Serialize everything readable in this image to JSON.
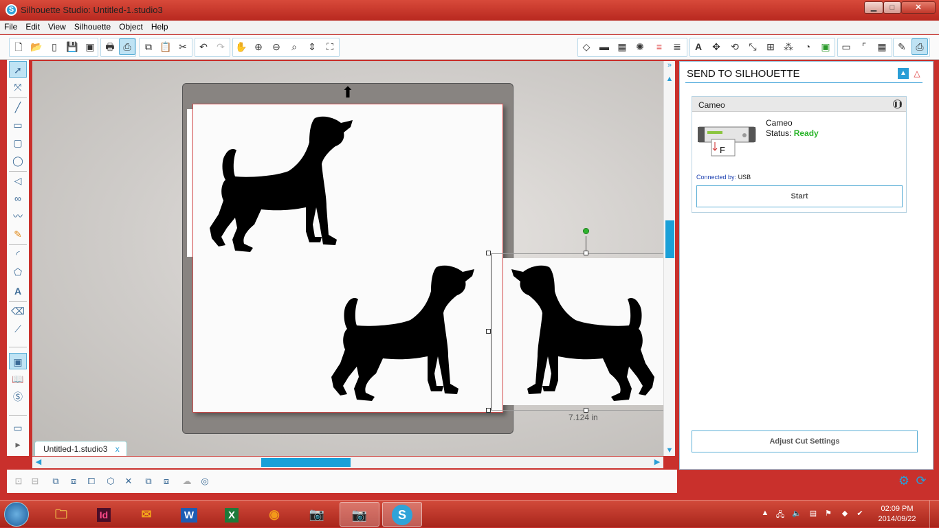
{
  "window": {
    "title": "Silhouette Studio: Untitled-1.studio3",
    "minimize": "▁",
    "maximize": "□",
    "close": "✕"
  },
  "menu": [
    "File",
    "Edit",
    "View",
    "Silhouette",
    "Object",
    "Help"
  ],
  "document": {
    "tab_label": "Untitled-1.studio3",
    "tab_close": "x",
    "dimension_label": "7.124 in"
  },
  "panel": {
    "title": "SEND TO SILHOUETTE",
    "device_header": "Cameo",
    "device_name": "Cameo",
    "status_label": "Status:",
    "status_value": "Ready",
    "connected_label": "Connected by:",
    "connected_value": "USB",
    "start_button": "Start",
    "adjust_button": "Adjust Cut Settings",
    "status_color": "#28b428"
  },
  "taskbar": {
    "clock_time": "02:09 PM",
    "clock_date": "2014/09/22"
  },
  "colors": {
    "accent": "#3aa0d8",
    "window_frame": "#c9302c"
  }
}
